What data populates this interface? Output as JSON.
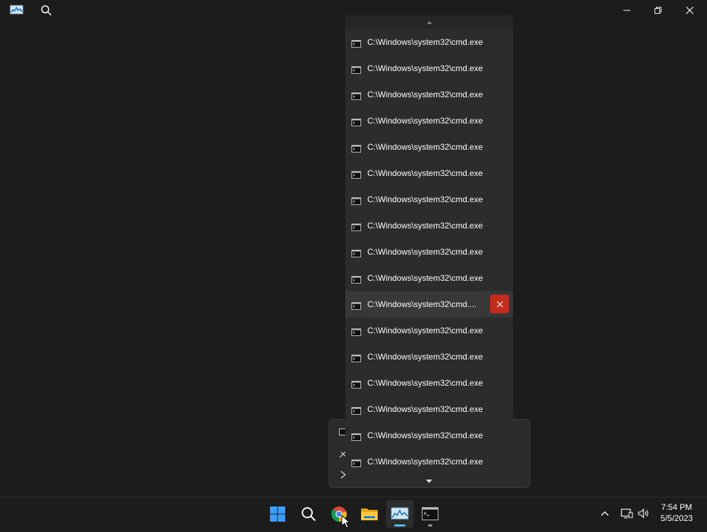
{
  "window": {
    "app_icon": "resource-monitor-icon",
    "search_icon": "search-icon",
    "controls": {
      "minimize": "minimize-icon",
      "maximize": "restore-icon",
      "close": "close-icon"
    }
  },
  "jumplist": {
    "items": [
      {
        "label": "C:\\Windows\\system32\\cmd.exe"
      },
      {
        "label": "C:\\Windows\\system32\\cmd.exe"
      },
      {
        "label": "C:\\Windows\\system32\\cmd.exe"
      },
      {
        "label": "C:\\Windows\\system32\\cmd.exe"
      },
      {
        "label": "C:\\Windows\\system32\\cmd.exe"
      },
      {
        "label": "C:\\Windows\\system32\\cmd.exe"
      },
      {
        "label": "C:\\Windows\\system32\\cmd.exe"
      },
      {
        "label": "C:\\Windows\\system32\\cmd.exe"
      },
      {
        "label": "C:\\Windows\\system32\\cmd.exe"
      },
      {
        "label": "C:\\Windows\\system32\\cmd.exe"
      },
      {
        "label": "C:\\Windows\\system32\\cmd...."
      },
      {
        "label": "C:\\Windows\\system32\\cmd.exe"
      },
      {
        "label": "C:\\Windows\\system32\\cmd.exe"
      },
      {
        "label": "C:\\Windows\\system32\\cmd.exe"
      },
      {
        "label": "C:\\Windows\\system32\\cmd.exe"
      },
      {
        "label": "C:\\Windows\\system32\\cmd.exe"
      },
      {
        "label": "C:\\Windows\\system32\\cmd.exe"
      }
    ],
    "hovered_index": 10,
    "remove_color": "#c42b1c"
  },
  "taskbar": {
    "apps": [
      {
        "name": "start-button",
        "icon": "windows-logo-icon"
      },
      {
        "name": "search-button",
        "icon": "search-icon"
      },
      {
        "name": "chrome-button",
        "icon": "chrome-icon"
      },
      {
        "name": "file-explorer-button",
        "icon": "folder-icon"
      },
      {
        "name": "resource-monitor-button",
        "icon": "resource-monitor-icon",
        "active": true
      },
      {
        "name": "command-prompt-button",
        "icon": "cmd-icon"
      }
    ],
    "accent": "#4cc2ff",
    "tray": {
      "chevron": "chevron-up-icon",
      "network": "network-icon",
      "volume": "volume-icon"
    },
    "clock": {
      "time": "7:54 PM",
      "date": "5/5/2023"
    }
  }
}
